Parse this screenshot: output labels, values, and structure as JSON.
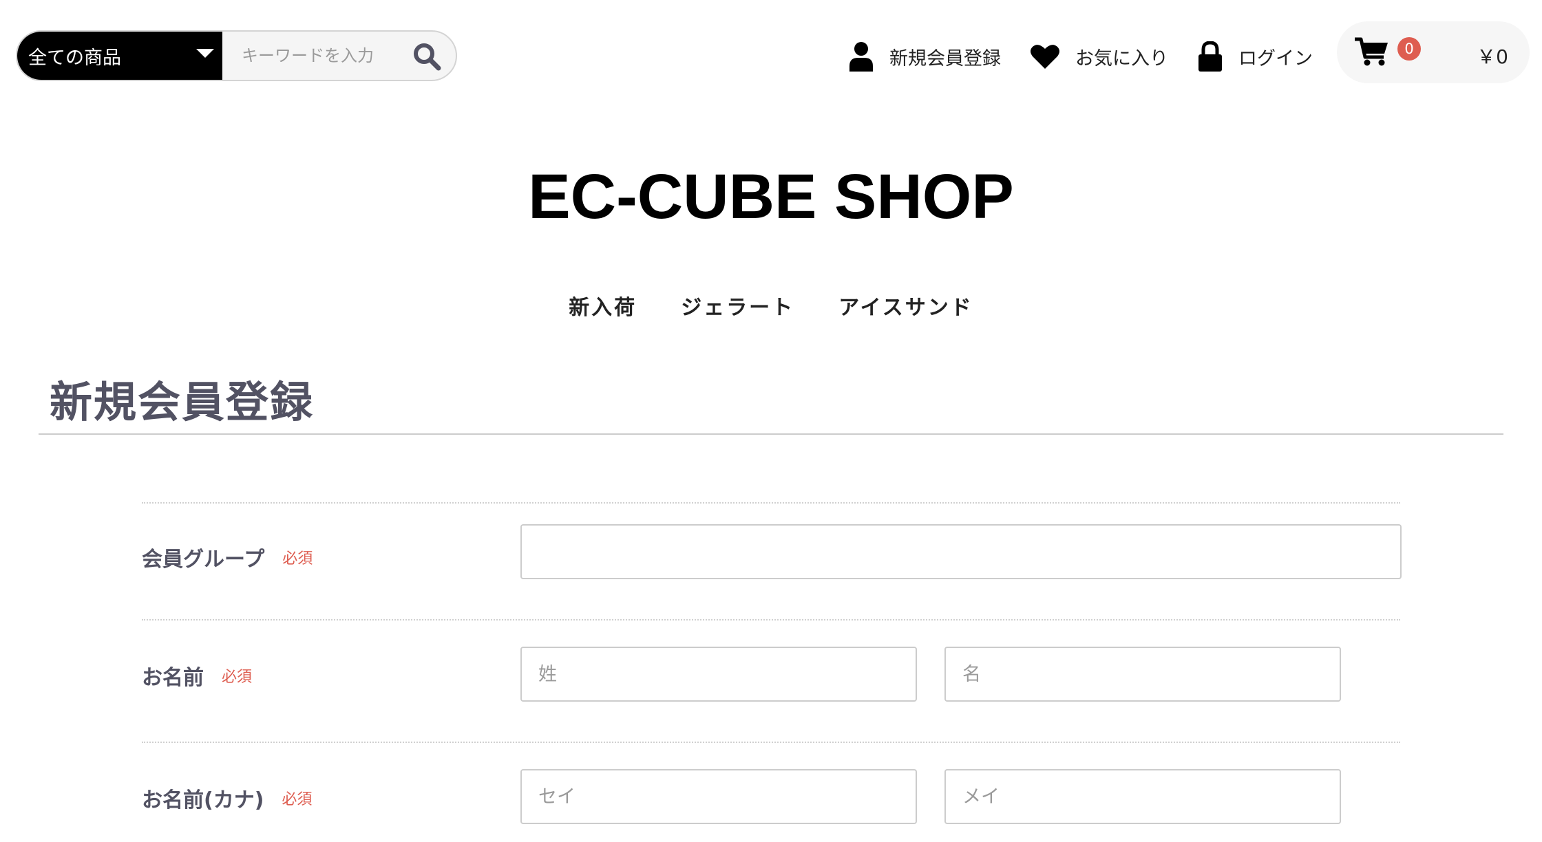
{
  "header": {
    "category_select": "全ての商品",
    "search_placeholder": "キーワードを入力",
    "links": {
      "register": "新規会員登録",
      "favorites": "お気に入り",
      "login": "ログイン"
    },
    "cart": {
      "count": "0",
      "price": "￥0"
    }
  },
  "logo": "EC-CUBE SHOP",
  "category_nav": [
    "新入荷",
    "ジェラート",
    "アイスサンド"
  ],
  "page_title": "新規会員登録",
  "form": {
    "required_label": "必須",
    "member_group": {
      "label": "会員グループ",
      "value": ""
    },
    "name": {
      "label": "お名前",
      "last_placeholder": "姓",
      "first_placeholder": "名"
    },
    "name_kana": {
      "label": "お名前(カナ)",
      "last_placeholder": "セイ",
      "first_placeholder": "メイ"
    }
  },
  "colors": {
    "accent": "#de5d50",
    "text": "#525263",
    "black": "#000000"
  }
}
